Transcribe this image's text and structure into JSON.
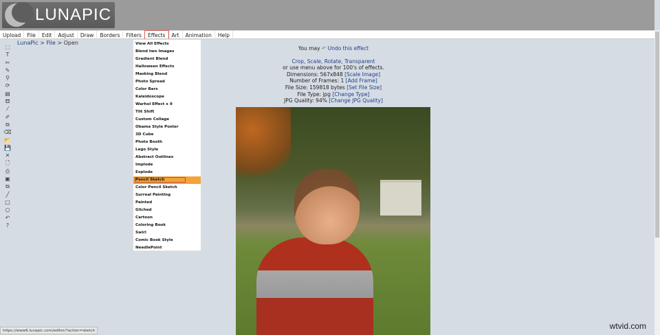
{
  "app": {
    "logo": "LUNAPIC"
  },
  "menu": [
    "Upload",
    "File",
    "Edit",
    "Adjust",
    "Draw",
    "Borders",
    "Filters",
    "Effects",
    "Art",
    "Animation",
    "Help"
  ],
  "breadcrumb": {
    "home": "LunaPic",
    "file": "File",
    "page": "Open"
  },
  "tools": [
    "select-icon",
    "text-icon",
    "scissors-icon",
    "pencil-icon",
    "zoom-icon",
    "rotate-icon",
    "gradient-icon",
    "fill-icon",
    "eyedropper-icon",
    "brush-icon",
    "crop-icon",
    "eraser-icon",
    "open-icon",
    "save-icon",
    "close-icon",
    "new-icon",
    "print-icon",
    "layers-icon",
    "copy-icon",
    "line-icon",
    "rectangle-icon",
    "circle-icon",
    "undo-icon",
    "help-icon"
  ],
  "tool_glyphs": [
    "⬚",
    "T",
    "✂",
    "✎",
    "⚲",
    "⟳",
    "▤",
    "⛾",
    "⁄",
    "✐",
    "⧉",
    "⌫",
    "📂",
    "💾",
    "✕",
    "🗋",
    "⎙",
    "▣",
    "⧉",
    "╱",
    "□",
    "○",
    "↶",
    "?"
  ],
  "effects_menu": {
    "items": [
      "View All Effects",
      "Blend two Images",
      "Gradient Blend",
      "Halloween Effects",
      "Masking Blend",
      "Photo Spread",
      "Color Bars",
      "Kaleidoscope",
      "Warhol Effect x 9",
      "Tilt Shift",
      "Custom Collage",
      "Obama Style Poster",
      "3D Cube",
      "Photo Booth",
      "Lego Style",
      "Abstract Outlines",
      "Implode",
      "Explode",
      "Pencil Sketch",
      "Color Pencil Sketch",
      "Surreal Painting",
      "Painted",
      "Gliched",
      "Cartoon",
      "Coloring Book",
      "Swirl",
      "Comic Book Style",
      "NeedlePoint"
    ],
    "selected": "Pencil Sketch"
  },
  "info": {
    "undo_prefix": "You may",
    "undo_link": "Undo this effect",
    "links_line": "Crop, Scale, Rotate, Transparent",
    "menu_hint": "or use menu above for 100's of effects.",
    "dimensions": "Dimensions: 567x848",
    "scale": "[Scale Image]",
    "frames": "Number of Frames: 1",
    "add_frame": "[Add Frame]",
    "file_size": "File Size: 159818 bytes",
    "set_size": "[Set File Size]",
    "file_type": "File Type: jpg",
    "change_type": "[Change Type]",
    "quality": "JPG Quality: 94%",
    "change_quality": "[Change JPG Quality]"
  },
  "status_url": "https://www6.lunapic.com/editor/?action=sketch",
  "watermark": "wtvid.com"
}
